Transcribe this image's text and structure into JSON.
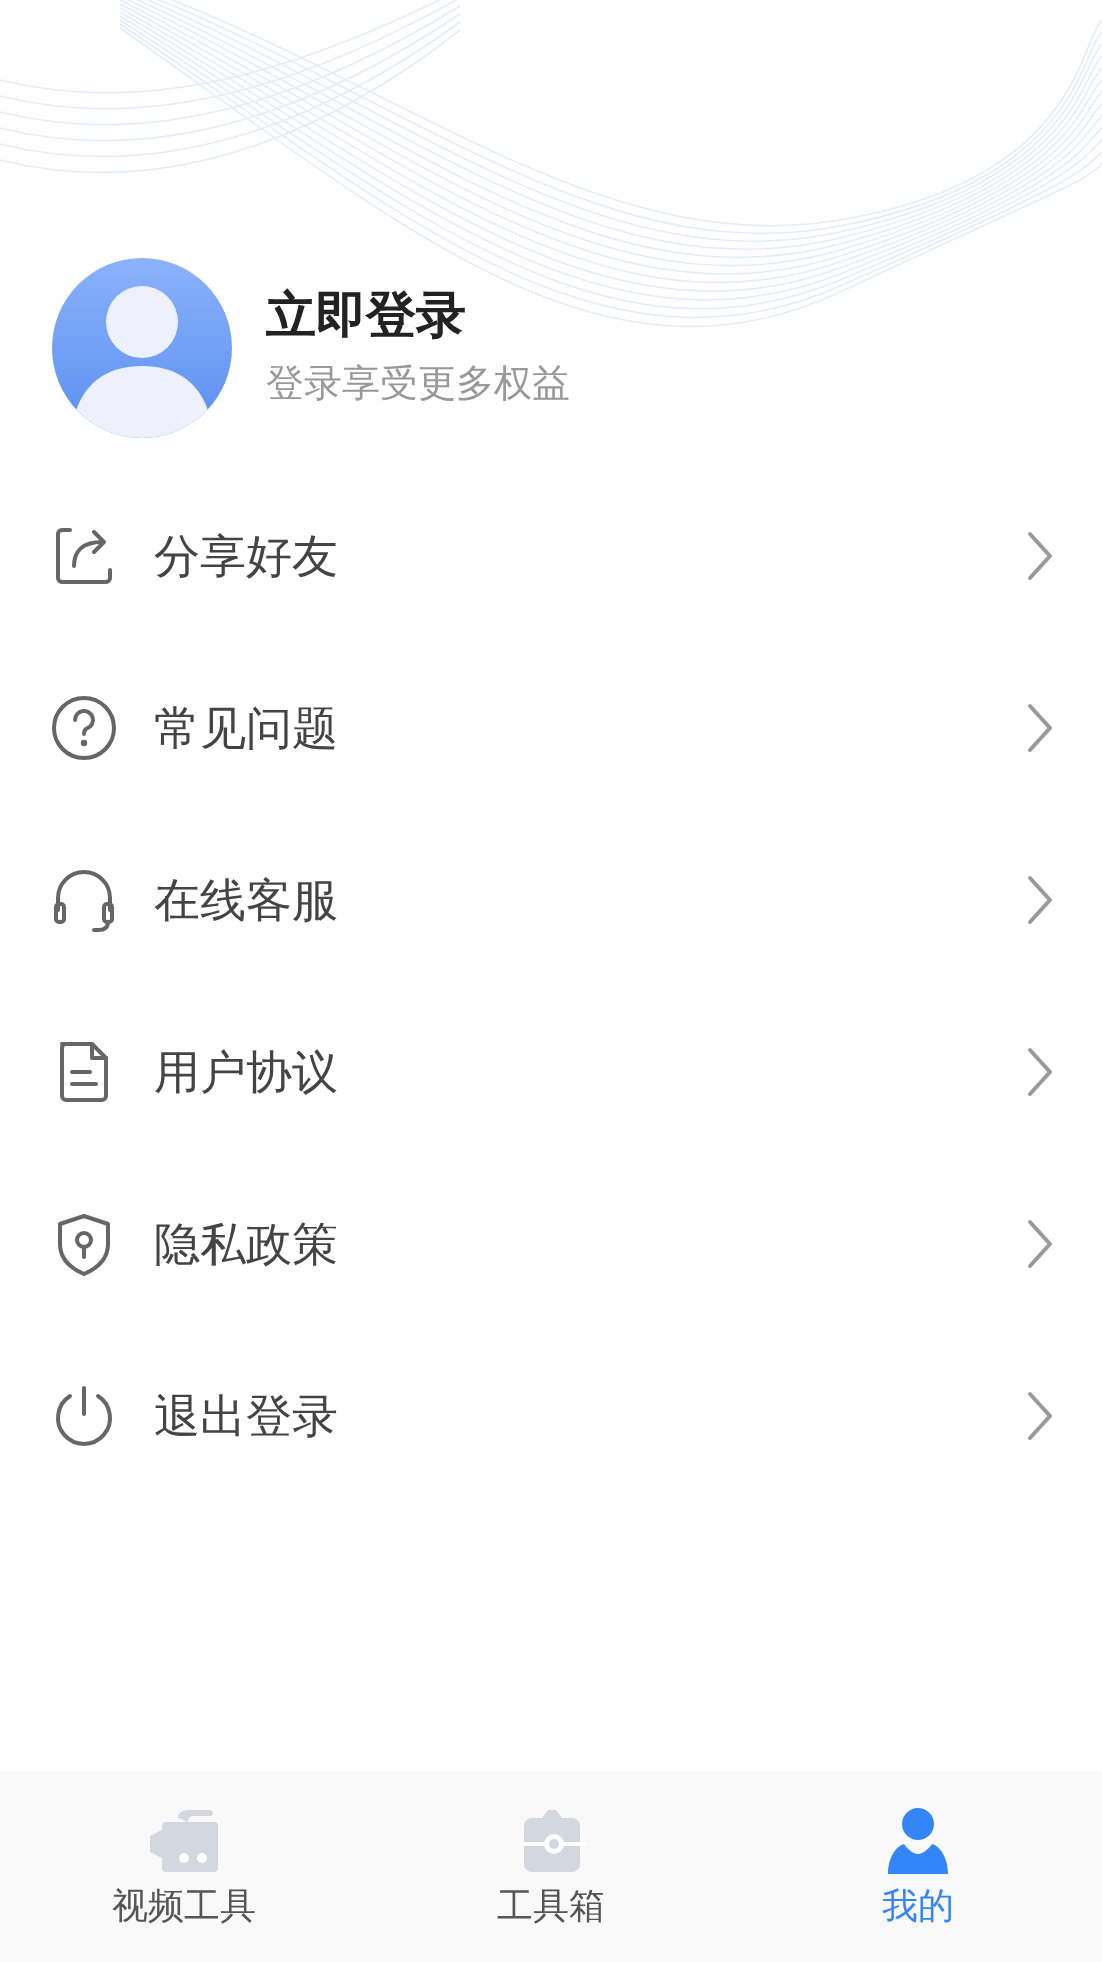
{
  "profile": {
    "title": "立即登录",
    "subtitle": "登录享受更多权益"
  },
  "menu": [
    {
      "kind": "share",
      "label": "分享好友"
    },
    {
      "kind": "help",
      "label": "常见问题"
    },
    {
      "kind": "support",
      "label": "在线客服"
    },
    {
      "kind": "agreement",
      "label": "用户协议"
    },
    {
      "kind": "privacy",
      "label": "隐私政策"
    },
    {
      "kind": "logout",
      "label": "退出登录"
    }
  ],
  "tabs": [
    {
      "kind": "video",
      "label": "视频工具",
      "selected": false
    },
    {
      "kind": "toolbox",
      "label": "工具箱",
      "selected": false
    },
    {
      "kind": "me",
      "label": "我的",
      "selected": true
    }
  ]
}
